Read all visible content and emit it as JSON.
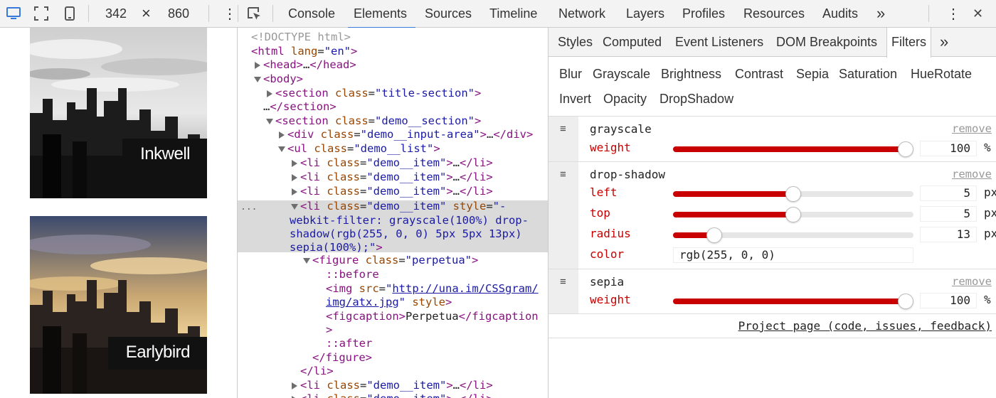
{
  "toolbar": {
    "width_value": "342",
    "times_glyph": "×",
    "height_value": "860",
    "tabs": [
      "Console",
      "Elements",
      "Sources",
      "Timeline",
      "Network",
      "Layers",
      "Profiles",
      "Resources",
      "Audits"
    ],
    "active_tab": "Elements",
    "more_glyph": "»",
    "menu_glyph": "⋮",
    "close_glyph": "✕",
    "icons": [
      "device-mode-icon",
      "responsive-frame-icon",
      "phone-icon",
      "menu-dots-icon",
      "inspect-element-icon",
      "more-tabs-icon",
      "close-icon"
    ]
  },
  "preview": {
    "captions": [
      "Inkwell",
      "Earlybird"
    ]
  },
  "tree": {
    "doctype": "<!DOCTYPE html>",
    "l_html_open": "<html",
    "l_html_attr": " lang",
    "l_html_val": "\"en\"",
    "l_html_close": ">",
    "l_head": "<head>",
    "l_head_ell": "…",
    "l_head_close": "</head>",
    "l_body": "<body>",
    "sec1_open": "<section",
    "sec1_attr": " class",
    "sec1_val": "\"title-section\"",
    "sec1_close": ">",
    "sec1_end_ell": "…",
    "sec1_end": "</section>",
    "sec2_open": "<section",
    "sec2_attr": " class",
    "sec2_val": "\"demo__section\"",
    "sec2_close": ">",
    "div_open": "<div",
    "div_attr": " class",
    "div_val": "\"demo__input-area\"",
    "div_close": ">",
    "div_ell": "…",
    "div_end": "</div>",
    "ul_open": "<ul",
    "ul_attr": " class",
    "ul_val": "\"demo__list\"",
    "ul_close": ">",
    "li_open": "<li",
    "li_attr": " class",
    "li_val": "\"demo__item\"",
    "li_close": ">",
    "li_ell": "…",
    "li_end": "</li>",
    "sel_ellipsis": "...",
    "sel_style_attr": " style",
    "sel_style_1": "\"-",
    "sel_style_2": "webkit-filter: grayscale(100%) drop-",
    "sel_style_3": "shadow(rgb(255, 0, 0) 5px 5px 13px)",
    "sel_style_4": "sepia(100%);\"",
    "fig_open": "<figure",
    "fig_attr": " class",
    "fig_val": "\"perpetua\"",
    "fig_close": ">",
    "before": "::before",
    "img_open": "<img",
    "img_attr": " src",
    "img_link_1": "http://una.im/CSSgram/",
    "img_link_2": "img/atx.jpg",
    "img_style": " style",
    "img_close": ">",
    "figcap_open": "<figcaption>",
    "figcap_text": "Perpetua",
    "figcap_close": "</figcaption",
    "figcap_close2": ">",
    "after": "::after",
    "fig_end": "</figure>",
    "li_end_line": "</li>"
  },
  "sidebar": {
    "tabs": [
      "Styles",
      "Computed",
      "Event Listeners",
      "DOM Breakpoints",
      "Filters"
    ],
    "active_tab": "Filters",
    "more_glyph": "»",
    "filter_buttons_row1": [
      "Blur",
      "Grayscale",
      "Brightness",
      "Contrast",
      "Sepia",
      "Saturation",
      "HueRotate"
    ],
    "filter_buttons_row2": [
      "Invert",
      "Opacity",
      "DropShadow"
    ],
    "handle_glyph": "≡",
    "remove_label": "remove",
    "filters": {
      "grayscale": {
        "name": "grayscale",
        "param": "weight",
        "value": "100",
        "unit": "%",
        "fraction": 1.0
      },
      "drop_shadow": {
        "name": "drop-shadow",
        "left": {
          "label": "left",
          "value": "5",
          "unit": "px",
          "fraction": 0.5
        },
        "top": {
          "label": "top",
          "value": "5",
          "unit": "px",
          "fraction": 0.5
        },
        "radius": {
          "label": "radius",
          "value": "13",
          "unit": "px",
          "fraction": 0.15
        },
        "color": {
          "label": "color",
          "value": "rgb(255, 0, 0)"
        }
      },
      "sepia": {
        "name": "sepia",
        "param": "weight",
        "value": "100",
        "unit": "%",
        "fraction": 1.0
      }
    },
    "project_link": "Project page (code, issues, feedback)"
  },
  "colors": {
    "accent": "#3879d9",
    "slider_fill": "#c80000",
    "tag": "#881280",
    "attr": "#994500",
    "value": "#1a1aa6"
  }
}
